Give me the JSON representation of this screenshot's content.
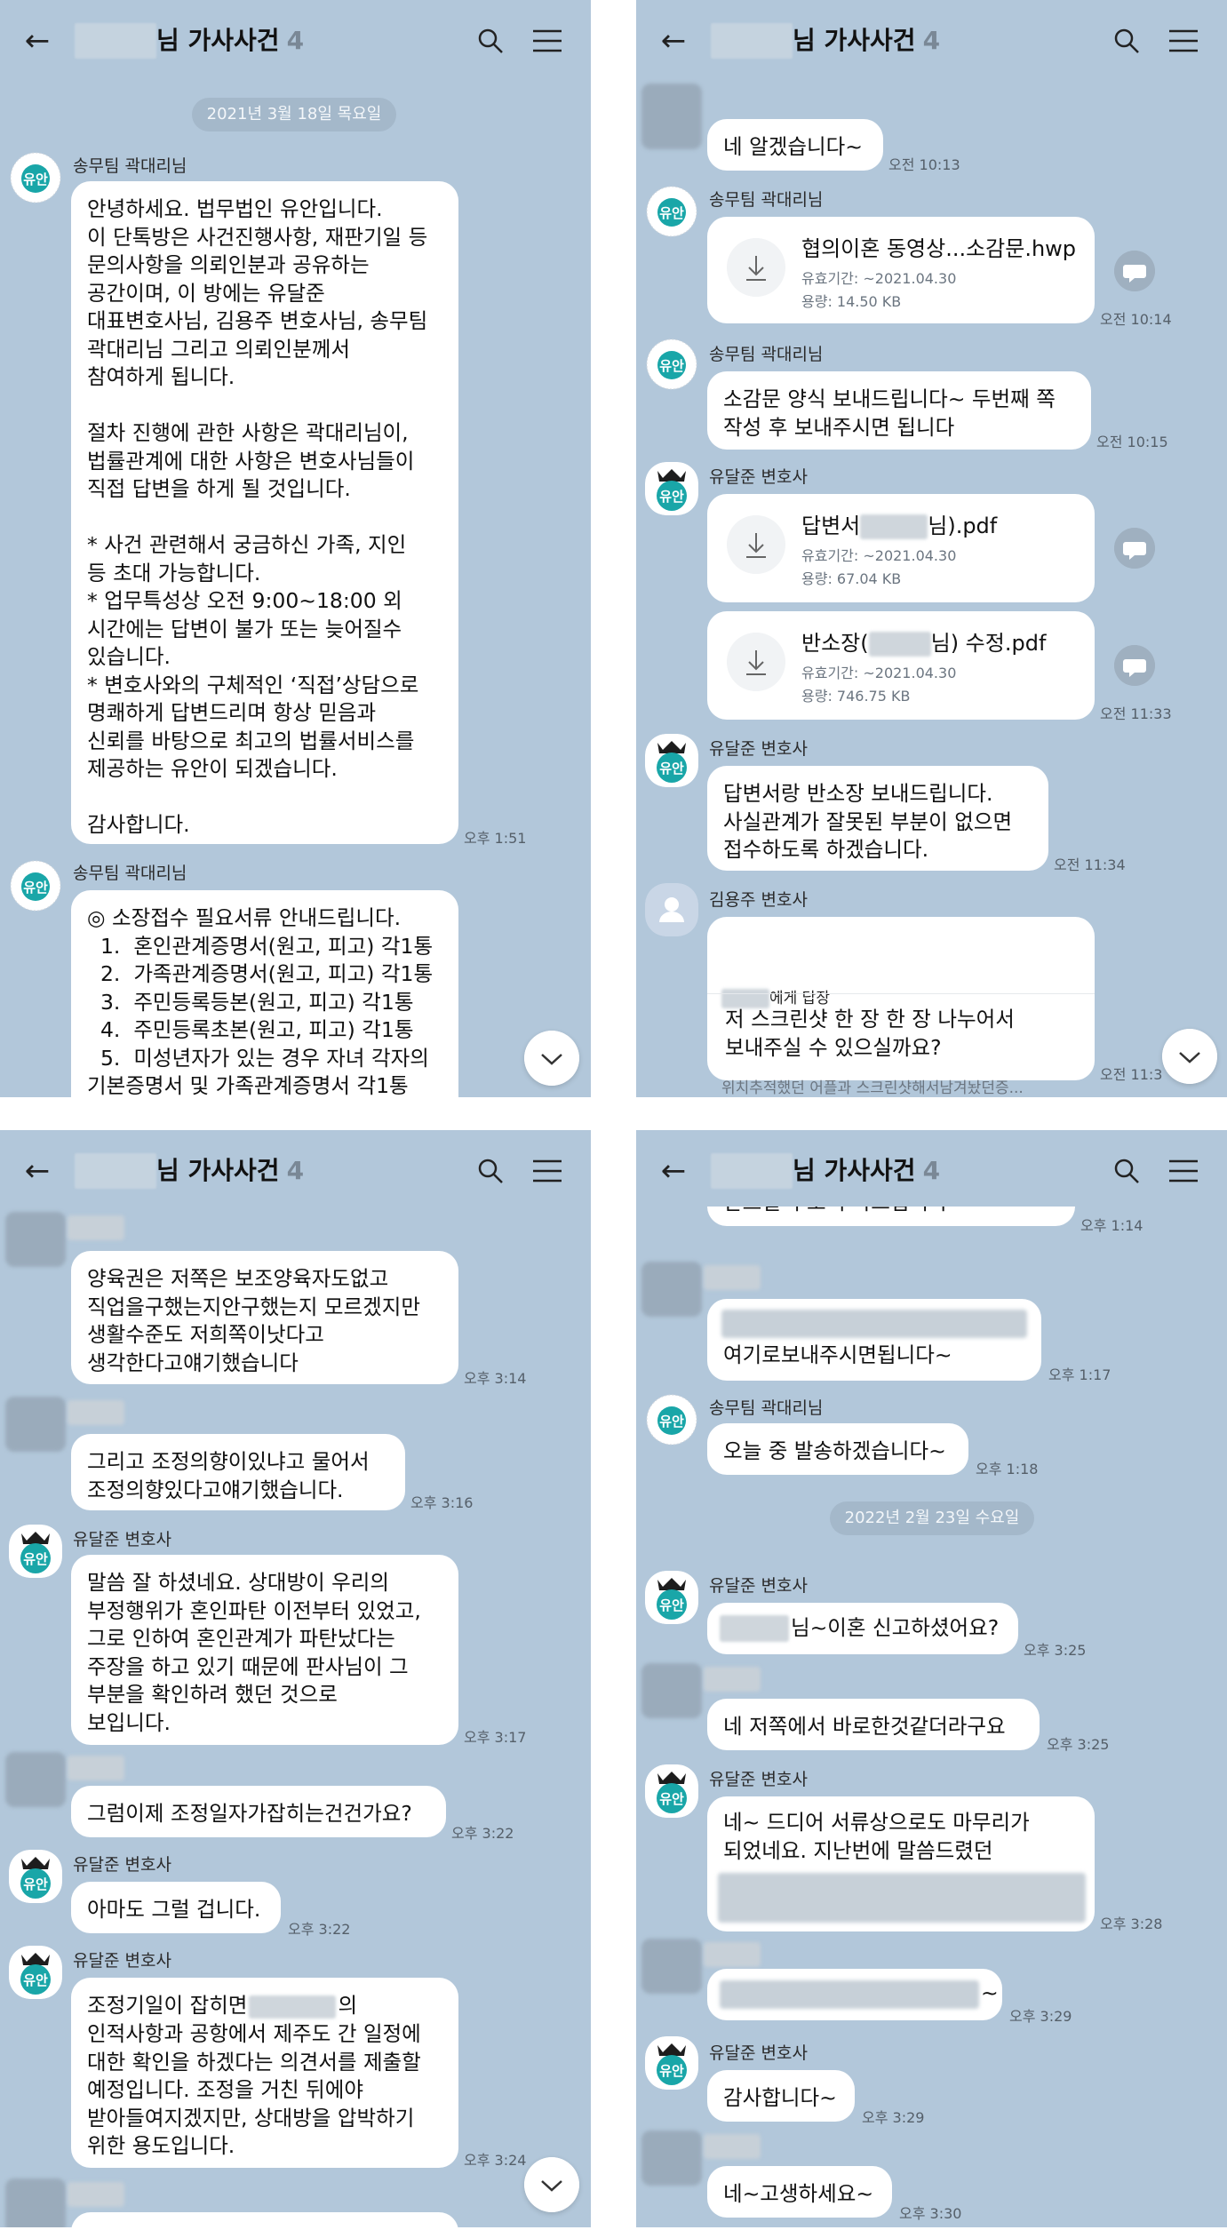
{
  "header": {
    "title": "님 가사사건",
    "count": "4"
  },
  "panel1": {
    "date": "2021년 3월 18일 목요일",
    "msg1": {
      "sender": "송무팀 곽대리님",
      "text": "안녕하세요. 법무법인 유안입니다.\n이 단톡방은 사건진행사항, 재판기일 등\n문의사항을 의뢰인분과 공유하는\n공간이며, 이 방에는 유달준\n대표변호사님, 김용주 변호사님, 송무팀\n곽대리님 그리고 의뢰인분께서\n참여하게 됩니다.\n\n절차 진행에 관한 사항은 곽대리님이,\n법률관계에 대한 사항은 변호사님들이\n직접 답변을 하게 될 것입니다.\n\n* 사건 관련해서 궁금하신 가족, 지인\n등 초대 가능합니다.\n* 업무특성상 오전 9:00~18:00 외\n시간에는 답변이 불가 또는 늦어질수\n있습니다.\n* 변호사와의 구체적인 ‘직접’상담으로\n명쾌하게 답변드리며 항상 믿음과\n신뢰를 바탕으로 최고의 법률서비스를\n제공하는 유안이 되겠습니다.\n\n감사합니다.",
      "time": "오후 1:51"
    },
    "msg2": {
      "sender": "송무팀 곽대리님",
      "text": "◎ 소장접수 필요서류 안내드립니다.\n  1.  혼인관계증명서(원고, 피고) 각1통\n  2.  가족관계증명서(원고, 피고) 각1통\n  3.  주민등록등본(원고, 피고) 각1통\n  4.  주민등록초본(원고, 피고) 각1통\n  5.  미성년자가 있는 경우 자녀 각자의\n기본증명서 및 가족관계증명서 각1통"
    }
  },
  "panel2": {
    "m1": {
      "text": "네 알겠습니다~",
      "time": "오전 10:13"
    },
    "m2": {
      "sender": "송무팀 곽대리님",
      "file": "협의이혼 동영상...소감문.hwp",
      "expire": "유효기간: ~2021.04.30",
      "size": "용량: 14.50 KB",
      "time": "오전 10:14"
    },
    "m3": {
      "sender": "송무팀 곽대리님",
      "text": "소감문 양식 보내드립니다~ 두번째 쪽\n작성 후 보내주시면 됩니다",
      "time": "오전 10:15"
    },
    "m4": {
      "sender": "유달준 변호사",
      "file1": {
        "pre": "답변서",
        "post": "님).pdf",
        "expire": "유효기간: ~2021.04.30",
        "size": "용량: 67.04 KB"
      },
      "file2": {
        "pre": "반소장(",
        "post": "님) 수정.pdf",
        "expire": "유효기간: ~2021.04.30",
        "size": "용량: 746.75 KB"
      },
      "time": "오전 11:33"
    },
    "m5": {
      "sender": "유달준 변호사",
      "text": "답변서랑 반소장 보내드립니다.\n사실관계가 잘못된 부분이 없으면\n접수하도록 하겠습니다.",
      "time": "오전 11:34"
    },
    "m6": {
      "sender": "김용주 변호사",
      "reply_to": "에게 답장",
      "quote": "위치추적했던 어플과 스크린샷해서남겨놨던증...",
      "text": "저 스크린샷 한 장 한 장 나누어서\n보내주실 수 있으실까요?",
      "time": "오전 11:3"
    }
  },
  "panel3": {
    "m1": {
      "text": "양육권은 저쪽은 보조양육자도없고\n직업을구했는지안구했는지 모르겠지만\n생활수준도 저희쪽이낫다고\n생각한다고얘기했습니다",
      "time": "오후 3:14"
    },
    "m2": {
      "text": "그리고 조정의향이있냐고 물어서\n조정의향있다고얘기했습니다.",
      "time": "오후 3:16"
    },
    "m3": {
      "sender": "유달준 변호사",
      "text": "말씀 잘 하셨네요. 상대방이 우리의\n부정행위가 혼인파탄 이전부터 있었고,\n그로 인하여 혼인관계가 파탄났다는\n주장을 하고 있기 때문에 판사님이 그\n부분을 확인하려 했던 것으로\n보입니다.",
      "time": "오후 3:17"
    },
    "m4": {
      "text": "그럼이제 조정일자가잡히는건건가요?",
      "time": "오후 3:22"
    },
    "m5": {
      "sender": "유달준 변호사",
      "text": "아마도 그럴 겁니다.",
      "time": "오후 3:22"
    },
    "m6": {
      "sender": "유달준 변호사",
      "pre": "조정기일이 잡히면",
      "post": "의",
      "text": "인적사항과 공항에서 제주도 간 일정에\n대한 확인을 하겠다는 의견서를 제출할\n예정입니다. 조정을 거친 뒤에야\n받아들여지겠지만, 상대방을 압박하기\n위한 용도입니다.",
      "time": "오후 3:24"
    }
  },
  "panel4": {
    "m0": {
      "text": "받으실 주소 부탁드립니다~",
      "time": "오후 1:14"
    },
    "m1": {
      "text": "여기로보내주시면됩니다~",
      "time": "오후 1:17"
    },
    "m2": {
      "sender": "송무팀 곽대리님",
      "text": "오늘 중 발송하겠습니다~",
      "time": "오후 1:18"
    },
    "date": "2022년 2월 23일 수요일",
    "m3": {
      "sender": "유달준 변호사",
      "text": "님~이혼 신고하셨어요?",
      "time": "오후 3:25"
    },
    "m4": {
      "text": "네 저쪽에서 바로한것같더라구요",
      "time": "오후 3:25"
    },
    "m5": {
      "sender": "유달준 변호사",
      "text": "네~ 드디어 서류상으로도 마무리가\n되었네요. 지난번에 말씀드렸던",
      "time": "오후 3:28"
    },
    "m6": {
      "text": "~",
      "time": "오후 3:29"
    },
    "m7": {
      "sender": "유달준 변호사",
      "text": "감사합니다~",
      "time": "오후 3:29"
    },
    "m8": {
      "text": "네~고생하세요~",
      "time": "오후 3:30"
    }
  },
  "colors": {
    "chat_bg": "#b2c7da",
    "bubble": "#ffffff",
    "date_pill": "#a4b8ca",
    "logo_teal": "#1aa6a6"
  },
  "icons": [
    "back-arrow-icon",
    "search-icon",
    "menu-icon",
    "download-icon",
    "share-icon",
    "chevron-down-icon",
    "law-firm-logo",
    "default-profile-icon"
  ]
}
